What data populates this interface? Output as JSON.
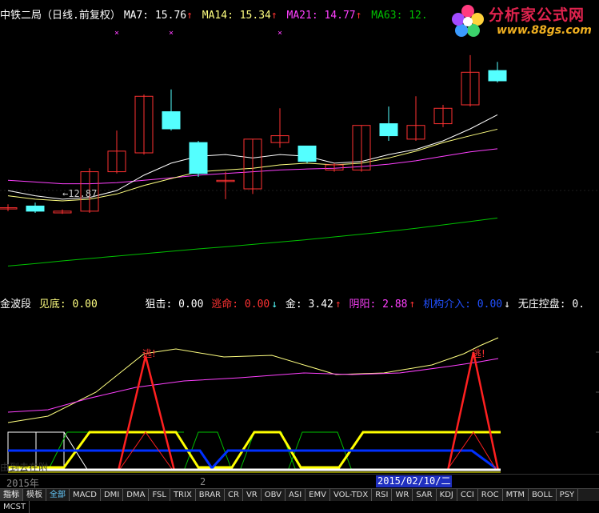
{
  "title_bar": {
    "stock": "中铁二局（日线.前复权）",
    "ma7": "MA7: 15.76",
    "ma14": "MA14: 15.34",
    "ma21": "MA21: 14.77",
    "ma63": "MA63: 12.",
    "up_arrow": "↑"
  },
  "logo": {
    "title": "分析家公式网",
    "url": "www.88gs.com"
  },
  "low_label": "←12.87",
  "indicator_bar": {
    "name": "金波段",
    "jiandi": "见底: 0.00",
    "juji": "狙击: 0.00",
    "taoming": "逃命: 0.00",
    "taoming_arrow": "↓",
    "jin": "金: 3.42",
    "jin_arrow": "↑",
    "yinyang": "阴阳: 2.88",
    "yinyang_arrow": "↑",
    "jigou": "机构介入: 0.00",
    "jigou_arrow": "↓",
    "wuzhuang": "无庄控盘: 0."
  },
  "escape_label": "逃!",
  "year_label": "2015年",
  "page_label": "2",
  "date_label": "2015/02/10/二",
  "faint_text": "由到去在附",
  "tabs": [
    "指标",
    "模板",
    "全部",
    "MACD",
    "DMI",
    "DMA",
    "FSL",
    "TRIX",
    "BRAR",
    "CR",
    "VR",
    "OBV",
    "ASI",
    "EMV",
    "VOL-TDX",
    "RSI",
    "WR",
    "SAR",
    "KDJ",
    "CCI",
    "ROC",
    "MTM",
    "BOLL",
    "PSY",
    "MCST"
  ],
  "colors": {
    "up": "#ff3232",
    "down": "#54ffff",
    "ma7": "#ffffff",
    "ma14": "#ffff80",
    "ma21": "#ff40ff",
    "ma63": "#00c000",
    "yellow": "#ffff00",
    "blue": "#0030ff"
  },
  "candles": [
    {
      "o": 13.05,
      "c": 13.05,
      "h": 13.15,
      "l": 12.95
    },
    {
      "o": 13.1,
      "c": 12.95,
      "h": 13.2,
      "l": 12.9
    },
    {
      "o": 12.9,
      "c": 12.95,
      "h": 13.0,
      "l": 12.87
    },
    {
      "o": 12.95,
      "c": 14.1,
      "h": 14.2,
      "l": 12.9
    },
    {
      "o": 14.1,
      "c": 14.7,
      "h": 15.3,
      "l": 14.05
    },
    {
      "o": 14.65,
      "c": 16.3,
      "h": 16.35,
      "l": 14.6
    },
    {
      "o": 15.85,
      "c": 15.35,
      "h": 16.5,
      "l": 15.3
    },
    {
      "o": 14.95,
      "c": 14.05,
      "h": 15.0,
      "l": 13.95
    },
    {
      "o": 13.85,
      "c": 13.85,
      "h": 14.1,
      "l": 13.3
    },
    {
      "o": 13.6,
      "c": 15.05,
      "h": 15.05,
      "l": 13.45
    },
    {
      "o": 14.95,
      "c": 15.15,
      "h": 15.95,
      "l": 14.8
    },
    {
      "o": 14.85,
      "c": 14.4,
      "h": 14.85,
      "l": 14.35
    },
    {
      "o": 14.15,
      "c": 14.3,
      "h": 14.35,
      "l": 14.1
    },
    {
      "o": 14.15,
      "c": 15.45,
      "h": 15.45,
      "l": 14.1
    },
    {
      "o": 15.5,
      "c": 15.15,
      "h": 16.0,
      "l": 15.0
    },
    {
      "o": 15.05,
      "c": 15.45,
      "h": 16.3,
      "l": 15.0
    },
    {
      "o": 15.5,
      "c": 15.95,
      "h": 16.05,
      "l": 15.4
    },
    {
      "o": 16.05,
      "c": 17.0,
      "h": 17.5,
      "l": 16.0
    },
    {
      "o": 17.05,
      "c": 16.75,
      "h": 17.3,
      "l": 16.7
    }
  ],
  "ma7_series": [
    13.55,
    13.4,
    13.3,
    13.35,
    13.55,
    14.0,
    14.35,
    14.55,
    14.6,
    14.5,
    14.6,
    14.55,
    14.35,
    14.4,
    14.6,
    14.75,
    15.0,
    15.35,
    15.76
  ],
  "ma14_series": [
    13.4,
    13.3,
    13.25,
    13.3,
    13.45,
    13.7,
    13.9,
    14.1,
    14.15,
    14.2,
    14.3,
    14.35,
    14.3,
    14.35,
    14.5,
    14.7,
    14.95,
    15.15,
    15.34
  ],
  "ma21_series": [
    13.85,
    13.8,
    13.75,
    13.75,
    13.78,
    13.85,
    13.92,
    14.0,
    14.05,
    14.1,
    14.15,
    14.18,
    14.2,
    14.25,
    14.32,
    14.42,
    14.55,
    14.68,
    14.77
  ],
  "ma63_series": [
    11.35,
    11.42,
    11.5,
    11.57,
    11.64,
    11.71,
    11.78,
    11.85,
    11.91,
    11.98,
    12.05,
    12.12,
    12.2,
    12.28,
    12.36,
    12.45,
    12.55,
    12.65,
    12.75
  ]
}
